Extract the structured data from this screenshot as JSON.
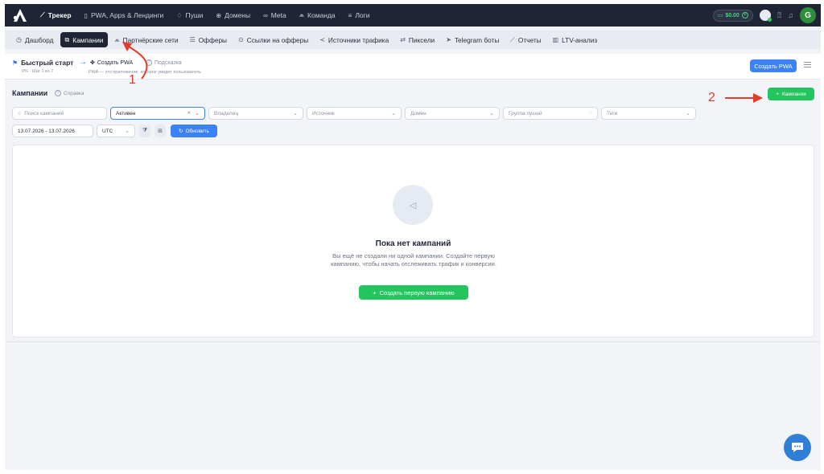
{
  "topnav": {
    "items": [
      {
        "label": "Трекер",
        "icon": "trend-icon",
        "active": true
      },
      {
        "label": "PWA, Apps & Лендинги",
        "icon": "phone-icon"
      },
      {
        "label": "Пуши",
        "icon": "bell-icon"
      },
      {
        "label": "Домены",
        "icon": "globe-icon"
      },
      {
        "label": "Meta",
        "icon": "meta-icon"
      },
      {
        "label": "Команда",
        "icon": "team-icon"
      },
      {
        "label": "Логи",
        "icon": "list-icon"
      }
    ],
    "balance": "$0.00",
    "avatar_letter": "G"
  },
  "subnav": {
    "items": [
      {
        "label": "Дашборд",
        "icon": "clock-icon"
      },
      {
        "label": "Кампании",
        "icon": "edit-icon",
        "active": true
      },
      {
        "label": "Партнёрские сети",
        "icon": "people-icon"
      },
      {
        "label": "Офферы",
        "icon": "stack-icon"
      },
      {
        "label": "Ссылки на офферы",
        "icon": "pin-icon"
      },
      {
        "label": "Источники трафика",
        "icon": "share-icon"
      },
      {
        "label": "Пиксели",
        "icon": "swap-icon"
      },
      {
        "label": "Telegram боты",
        "icon": "telegram-icon"
      },
      {
        "label": "Отчеты",
        "icon": "report-icon"
      },
      {
        "label": "LTV-анализ",
        "icon": "bar-chart-icon"
      }
    ]
  },
  "quickstart": {
    "title": "Быстрый старт",
    "progress": "0% · Шаг 1 из 7",
    "step": "Создать PWA",
    "hint": "Подсказка",
    "description": "PWA — это приложение, которое увидит пользователь",
    "create_button": "Создать PWA"
  },
  "campaigns": {
    "title": "Кампании",
    "help": "Справка",
    "add_button": "Кампания"
  },
  "filters": {
    "search_placeholder": "Поиск кампаний",
    "status": "Активен",
    "owner": "Владелец",
    "source": "Источник",
    "domain": "Домен",
    "push_group": "Группа пушей",
    "tags": "Теги",
    "date_range": "13.07.2026 - 13.07.2026",
    "timezone": "UTC",
    "refresh": "Обновить"
  },
  "empty_state": {
    "title": "Пока нет кампаний",
    "text": "Вы ещё не создали ни одной кампании. Создайте первую кампанию, чтобы начать отслеживать трафик и конверсии.",
    "button": "Создать первую кампанию"
  },
  "annotations": {
    "one": "1",
    "two": "2",
    "color": "#e23b2a"
  }
}
